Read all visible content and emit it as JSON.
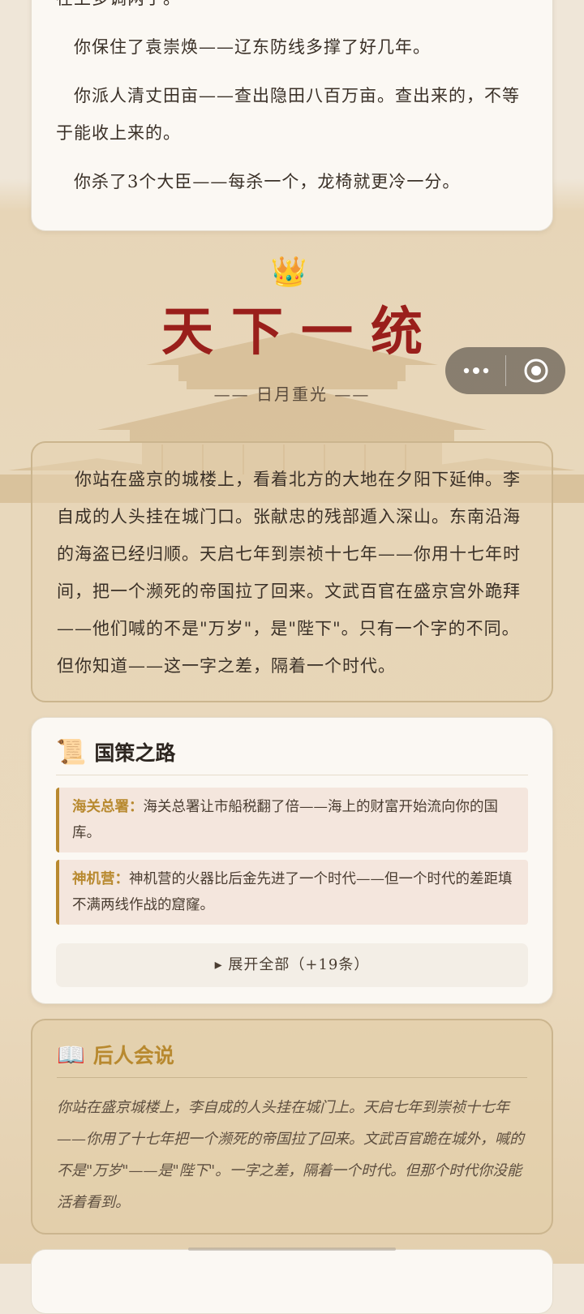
{
  "top_card": {
    "cut_line": "在上多调两于。",
    "lines": [
      "你保住了袁崇焕——辽东防线多撑了好几年。",
      "你派人清丈田亩——查出隐田八百万亩。查出来的，不等于能收上来的。",
      "你杀了3个大臣——每杀一个，龙椅就更冷一分。"
    ]
  },
  "ending": {
    "crown_icon": "👑",
    "title": "天下一统",
    "subtitle": "—— 日月重光 ——"
  },
  "mini_program": {
    "more_icon": "more-dots-icon",
    "close_icon": "target-circle-icon"
  },
  "story": {
    "text": "你站在盛京的城楼上，看着北方的大地在夕阳下延伸。李自成的人头挂在城门口。张献忠的残部遁入深山。东南沿海的海盗已经归顺。天启七年到崇祯十七年——你用十七年时间，把一个濒死的帝国拉了回来。文武百官在盛京宫外跪拜——他们喊的不是\"万岁\"，是\"陛下\"。只有一个字的不同。但你知道——这一字之差，隔着一个时代。"
  },
  "policy": {
    "icon": "📜",
    "title": "国策之路",
    "items": [
      {
        "key": "海关总署：",
        "text": "海关总署让市船税翻了倍——海上的财富开始流向你的国库。"
      },
      {
        "key": "神机营：",
        "text": "神机营的火器比后金先进了一个时代——但一个时代的差距填不满两线作战的窟窿。"
      }
    ],
    "expand_label": "▸ 展开全部（+19条）"
  },
  "later": {
    "icon": "📖",
    "title": "后人会说",
    "text": "你站在盛京城楼上，李自成的人头挂在城门上。天启七年到崇祯十七年——你用了十七年把一个濒死的帝国拉了回来。文武百官跪在城外，喊的不是\"万岁\"——是\"陛下\"。一字之差，隔着一个时代。但那个时代你没能活着看到。"
  }
}
